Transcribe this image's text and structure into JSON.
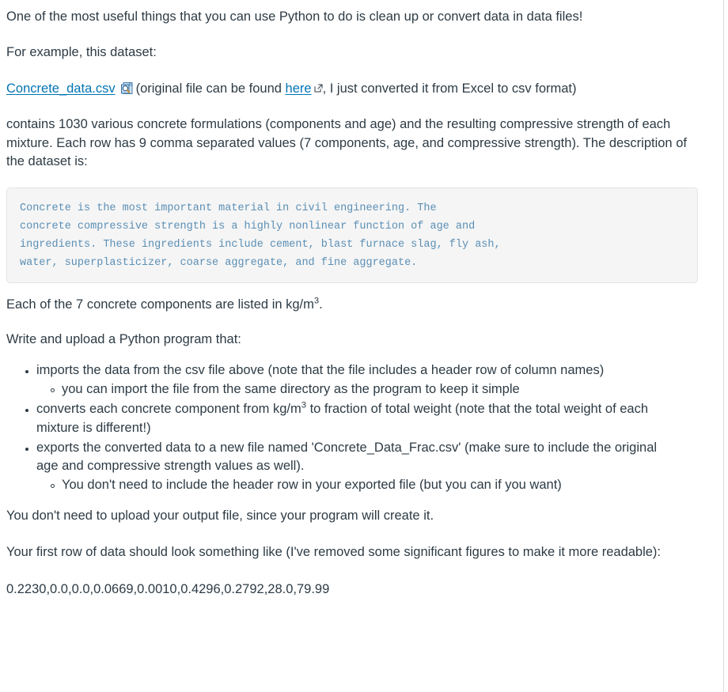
{
  "intro": {
    "line1": "One of the most useful things that you can use Python to do is clean up or convert data in data files!",
    "line2": "For example, this dataset:"
  },
  "dataset_link": {
    "file_label": "Concrete_data.csv",
    "preview_icon": "document-preview-icon",
    "paren_open": "(original",
    "mid_text": " file can be found ",
    "here_label": "here",
    "external_icon": "external-link-icon",
    "after_text": ", I just converted it from Excel to csv format)"
  },
  "description": {
    "paragraph": "contains 1030  various concrete formulations (components and age) and the resulting compressive strength of each mixture.  Each row has 9 comma separated values (7 components, age, and compressive strength).  The description of the dataset is:"
  },
  "code_block": {
    "text": "Concrete is the most important material in civil engineering. The\nconcrete compressive strength is a highly nonlinear function of age and\ningredients. These ingredients include cement, blast furnace slag, fly ash,\nwater, superplasticizer, coarse aggregate, and fine aggregate."
  },
  "units_note": {
    "prefix": "Each of the 7 concrete components are listed in kg/m",
    "superscript": "3",
    "suffix": "."
  },
  "instructions_heading": "Write and upload a Python program that:",
  "tasks": [
    {
      "text": "imports the data from the csv file above (note that the file includes a header row of column names)",
      "subitems": [
        "you can import the file from the same directory as the program to keep it simple"
      ]
    },
    {
      "text_prefix": "converts each concrete component from kg/m",
      "superscript": "3",
      "text_suffix": " to fraction of total weight (note that the total weight of each mixture is different!)",
      "subitems": []
    },
    {
      "text": "exports the converted data to a new file named 'Concrete_Data_Frac.csv' (make sure to include the original age and compressive strength values as well).",
      "subitems": [
        "You don't need to include the header row in your exported file (but you can if you want)"
      ]
    }
  ],
  "closing": {
    "no_upload": "You don't need to upload your output file, since your program will create it.",
    "first_row_note": "Your first row of data should look something like (I've removed some significant figures to make it more readable):",
    "data_row": "0.2230,0.0,0.0,0.0669,0.0010,0.4296,0.2792,28.0,79.99"
  },
  "colors": {
    "text": "#2d3b45",
    "link": "#0374b5",
    "code_text": "#5b8fb5",
    "code_bg": "#f5f5f5",
    "code_border": "#e2e4e6"
  }
}
